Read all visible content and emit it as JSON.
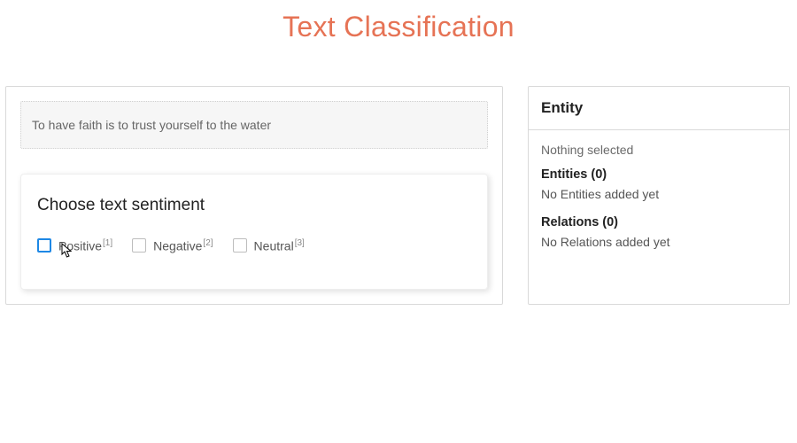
{
  "page": {
    "title": "Text Classification"
  },
  "sample": {
    "text": "To have faith is to trust yourself to the water"
  },
  "sentiment": {
    "title": "Choose text sentiment",
    "options": [
      {
        "label": "Positive",
        "hotkey": "[1]",
        "focused": true
      },
      {
        "label": "Negative",
        "hotkey": "[2]",
        "focused": false
      },
      {
        "label": "Neutral",
        "hotkey": "[3]",
        "focused": false
      }
    ]
  },
  "entity_panel": {
    "header": "Entity",
    "selection": "Nothing selected",
    "entities": {
      "label": "Entities (0)",
      "empty": "No Entities added yet"
    },
    "relations": {
      "label": "Relations (0)",
      "empty": "No Relations added yet"
    }
  }
}
